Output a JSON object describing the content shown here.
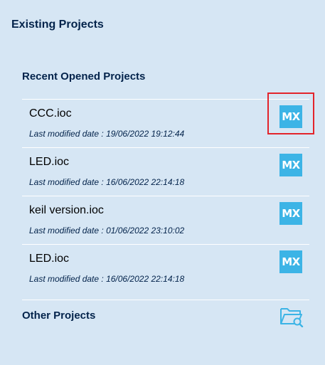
{
  "panel": {
    "title": "Existing Projects"
  },
  "recent": {
    "title": "Recent Opened Projects",
    "items": [
      {
        "name": "CCC.ioc",
        "date": "Last modified date : 19/06/2022 19:12:44",
        "icon": "MX"
      },
      {
        "name": "LED.ioc",
        "date": "Last modified date : 16/06/2022 22:14:18",
        "icon": "MX"
      },
      {
        "name": "keil version.ioc",
        "date": "Last modified date : 01/06/2022 23:10:02",
        "icon": "MX"
      },
      {
        "name": "LED.ioc",
        "date": "Last modified date : 16/06/2022 22:14:18",
        "icon": "MX"
      }
    ]
  },
  "other": {
    "title": "Other Projects",
    "icon": "folder-search-icon"
  },
  "colors": {
    "background": "#d6e6f4",
    "accent": "#3cb4e6",
    "text": "#03234b",
    "highlight": "#e3242b"
  }
}
